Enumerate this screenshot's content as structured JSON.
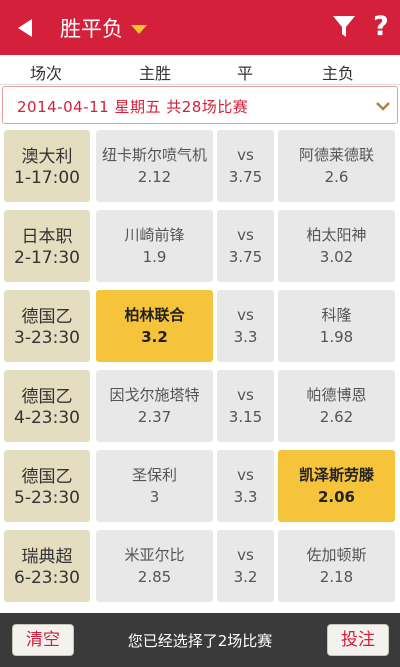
{
  "header": {
    "title": "胜平负",
    "help": "?",
    "icons": {
      "back": "back-arrow-icon",
      "title_dropdown": "caret-down-icon",
      "filter": "funnel-filter-icon"
    },
    "colors": {
      "bar": "#d4203a",
      "caret": "#f2c230"
    }
  },
  "columns": [
    "场次",
    "主胜",
    "平",
    "主负"
  ],
  "date_bar": {
    "text": "2014-04-11  星期五  共28场比赛",
    "icon": "chevron-down-icon"
  },
  "matches": [
    {
      "league": "澳大利",
      "time": "1-17:00",
      "home": "纽卡斯尔喷气机",
      "home_odds": "2.12",
      "vs": "vs",
      "draw_odds": "3.75",
      "away": "阿德莱德联",
      "away_odds": "2.6"
    },
    {
      "league": "日本职",
      "time": "2-17:30",
      "home": "川崎前锋",
      "home_odds": "1.9",
      "vs": "vs",
      "draw_odds": "3.75",
      "away": "柏太阳神",
      "away_odds": "3.02"
    },
    {
      "league": "德国乙",
      "time": "3-23:30",
      "home": "柏林联合",
      "home_odds": "3.2",
      "vs": "vs",
      "draw_odds": "3.3",
      "away": "科隆",
      "away_odds": "1.98"
    },
    {
      "league": "德国乙",
      "time": "4-23:30",
      "home": "因戈尔施塔特",
      "home_odds": "2.37",
      "vs": "vs",
      "draw_odds": "3.15",
      "away": "帕德博恩",
      "away_odds": "2.62"
    },
    {
      "league": "德国乙",
      "time": "5-23:30",
      "home": "圣保利",
      "home_odds": "3",
      "vs": "vs",
      "draw_odds": "3.3",
      "away": "凯泽斯劳滕",
      "away_odds": "2.06"
    },
    {
      "league": "瑞典超",
      "time": "6-23:30",
      "home": "米亚尔比",
      "home_odds": "2.85",
      "vs": "vs",
      "draw_odds": "3.2",
      "away": "佐加顿斯",
      "away_odds": "2.18"
    }
  ],
  "selected_color": "#f5c43a",
  "footer": {
    "clear": "清空",
    "message": "您已经选择了2场比赛",
    "bet": "投注"
  }
}
